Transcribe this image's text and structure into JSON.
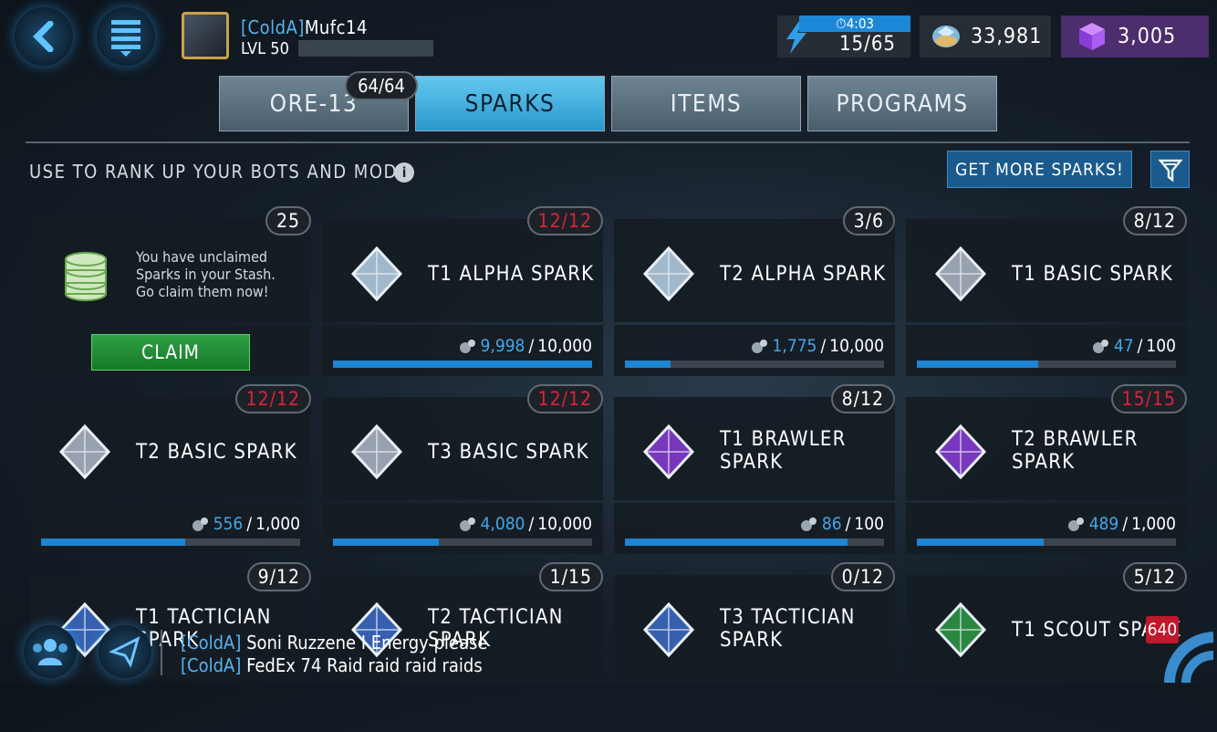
{
  "header": {
    "player_clan": "[ColdA]",
    "player_name": "Mufc14",
    "level_label": "LVL 50",
    "energy_timer": "4:03",
    "energy_value": "15/65",
    "shards": "33,981",
    "cybercoins": "3,005"
  },
  "tabs": [
    {
      "label": "ORE-13",
      "active": false,
      "badge": "64/64"
    },
    {
      "label": "SPARKS",
      "active": true
    },
    {
      "label": "ITEMS",
      "active": false
    },
    {
      "label": "PROGRAMS",
      "active": false
    }
  ],
  "subheader": {
    "hint": "USE TO RANK UP YOUR BOTS AND MODS",
    "get_more_label": "GET MORE SPARKS!"
  },
  "stash": {
    "count": "25",
    "text": "You have unclaimed\nSparks in your Stash.\nGo claim them now!",
    "claim_label": "CLAIM"
  },
  "sparks": [
    {
      "name": "T1 ALPHA SPARK",
      "badge": "12/12",
      "full": true,
      "current": "9,998",
      "max": "10,000",
      "fraction": 0.9998,
      "color": "#b8d4ea"
    },
    {
      "name": "T2 ALPHA SPARK",
      "badge": "3/6",
      "full": false,
      "current": "1,775",
      "max": "10,000",
      "fraction": 0.1775,
      "color": "#b8d4ea"
    },
    {
      "name": "T1 BASIC SPARK",
      "badge": "8/12",
      "full": false,
      "current": "47",
      "max": "100",
      "fraction": 0.47,
      "color": "#aeb8c8"
    },
    {
      "name": "T2 BASIC SPARK",
      "badge": "12/12",
      "full": true,
      "current": "556",
      "max": "1,000",
      "fraction": 0.556,
      "color": "#aeb8c8"
    },
    {
      "name": "T3 BASIC SPARK",
      "badge": "12/12",
      "full": true,
      "current": "4,080",
      "max": "10,000",
      "fraction": 0.408,
      "color": "#aeb8c8"
    },
    {
      "name": "T1 BRAWLER SPARK",
      "badge": "8/12",
      "full": false,
      "current": "86",
      "max": "100",
      "fraction": 0.86,
      "color": "#8a3cd8"
    },
    {
      "name": "T2 BRAWLER SPARK",
      "badge": "15/15",
      "full": true,
      "current": "489",
      "max": "1,000",
      "fraction": 0.489,
      "color": "#8a3cd8"
    },
    {
      "name": "T1 TACTICIAN SPARK",
      "badge": "9/12",
      "full": false,
      "color": "#3c6cc8"
    },
    {
      "name": "T2 TACTICIAN SPARK",
      "badge": "1/15",
      "full": false,
      "color": "#3c6cc8"
    },
    {
      "name": "T3 TACTICIAN SPARK",
      "badge": "0/12",
      "full": false,
      "color": "#3c6cc8"
    },
    {
      "name": "T1 SCOUT SPARK",
      "badge": "5/12",
      "full": false,
      "color": "#2e9a48"
    }
  ],
  "chat": [
    {
      "clan": "[ColdA]",
      "message": "Soni Ruzzene I Energy please"
    },
    {
      "clan": "[ColdA]",
      "message": "FedEx 74 Raid raid raid raids"
    }
  ],
  "side_badge": "640",
  "colors": {
    "accent": "#2a98cc",
    "progress": "#1f84d1",
    "full_badge": "#d9243a",
    "claim": "#2fa044"
  }
}
